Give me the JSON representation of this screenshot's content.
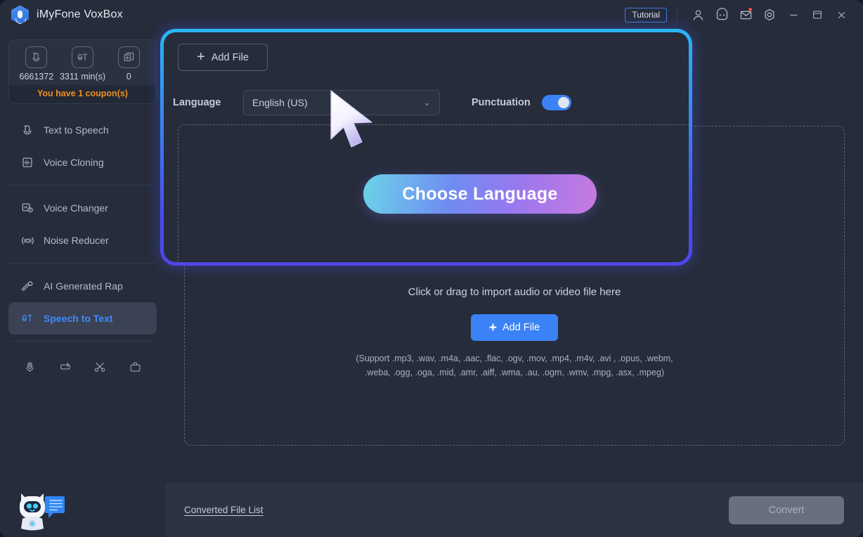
{
  "titlebar": {
    "app_title": "iMyFone VoxBox",
    "tutorial_label": "Tutorial",
    "icons": [
      "account-icon",
      "community-icon",
      "mail-icon",
      "settings-icon",
      "minimize-icon",
      "maximize-icon",
      "close-icon"
    ]
  },
  "sidebar": {
    "credits": [
      {
        "icon": "text-to-speech-credit-icon",
        "value": "6661372"
      },
      {
        "icon": "speech-to-text-credit-icon",
        "value": "3311 min(s)"
      },
      {
        "icon": "clone-credit-icon",
        "value": "0"
      }
    ],
    "coupon_text": "You have 1 coupon(s)",
    "items": [
      {
        "label": "Text to Speech",
        "icon": "text-to-speech-icon",
        "active": false
      },
      {
        "label": "Voice Cloning",
        "icon": "voice-cloning-icon",
        "active": false
      },
      {
        "label": "Voice Changer",
        "icon": "voice-changer-icon",
        "active": false
      },
      {
        "label": "Noise Reducer",
        "icon": "noise-reducer-icon",
        "active": false
      },
      {
        "label": "AI Generated Rap",
        "icon": "ai-rap-icon",
        "active": false
      },
      {
        "label": "Speech to Text",
        "icon": "speech-to-text-icon",
        "active": true
      }
    ],
    "tools": [
      "recorder-icon",
      "loop-icon",
      "scissors-icon",
      "toolbox-icon"
    ],
    "mascot": "chatbot-mascot"
  },
  "main": {
    "add_file_top_label": "Add File",
    "language_label": "Language",
    "language_value": "English (US)",
    "punctuation_label": "Punctuation",
    "punctuation_on": true,
    "dropzone": {
      "title": "Click or drag to import audio or video file here",
      "add_file_label": "Add File",
      "support_line1": "(Support .mp3, .wav, .m4a, .aac, .flac, .ogv, .mov, .mp4, .m4v, .avi , .opus, .webm,",
      "support_line2": ".weba, .ogg, .oga, .mid, .amr, .aiff, .wma, .au, .ogm, .wmv, .mpg, .asx, .mpeg)"
    },
    "converted_file_list_label": "Converted File List",
    "convert_label": "Convert"
  },
  "callout": {
    "label": "Choose Language"
  },
  "colors": {
    "accent_blue": "#3b82f6",
    "coupon_orange": "#f0911f",
    "highlight_top": "#29b6f5",
    "highlight_bottom": "#4f46e8",
    "callout_left": "#6cd3e8",
    "callout_right": "#c77ae0",
    "sidebar_bg": "#262c3a",
    "active_item_bg": "#3a4254"
  }
}
